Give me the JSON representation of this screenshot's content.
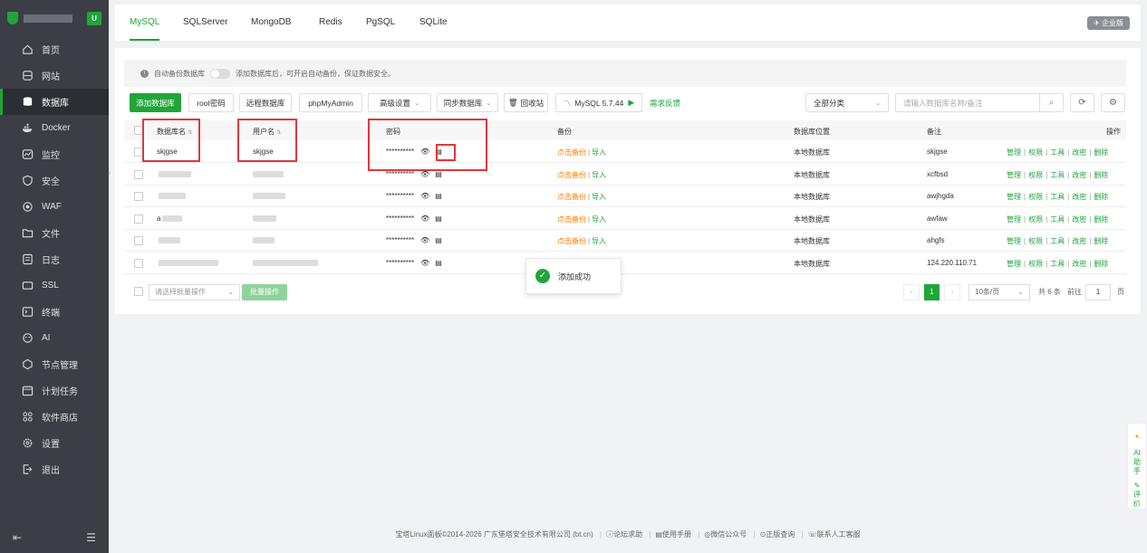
{
  "sidebar": {
    "badge": "U",
    "items": [
      {
        "label": "首页",
        "icon": "home-icon"
      },
      {
        "label": "网站",
        "icon": "globe-icon"
      },
      {
        "label": "数据库",
        "icon": "database-icon",
        "active": true
      },
      {
        "label": "Docker",
        "icon": "docker-icon"
      },
      {
        "label": "监控",
        "icon": "monitor-icon"
      },
      {
        "label": "安全",
        "icon": "shield-icon"
      },
      {
        "label": "WAF",
        "icon": "waf-icon"
      },
      {
        "label": "文件",
        "icon": "folder-icon"
      },
      {
        "label": "日志",
        "icon": "log-icon"
      },
      {
        "label": "SSL",
        "icon": "ssl-icon"
      },
      {
        "label": "终端",
        "icon": "terminal-icon"
      },
      {
        "label": "AI",
        "icon": "ai-icon"
      },
      {
        "label": "节点管理",
        "icon": "node-icon"
      },
      {
        "label": "计划任务",
        "icon": "calendar-icon"
      },
      {
        "label": "软件商店",
        "icon": "store-icon"
      },
      {
        "label": "设置",
        "icon": "gear-icon"
      },
      {
        "label": "退出",
        "icon": "logout-icon"
      }
    ]
  },
  "tabs": [
    "MySQL",
    "SQLServer",
    "MongoDB",
    "Redis",
    "PgSQL",
    "SQLite"
  ],
  "enterprise_badge": "企业版",
  "notice": {
    "label": "自动备份数据库",
    "text": "添加数据库后，可开启自动备份，保证数据安全。"
  },
  "toolbar": {
    "add_db": "添加数据库",
    "root_pwd": "root密码",
    "remote_db": "远程数据库",
    "phpmyadmin": "phpMyAdmin",
    "advanced": "高级设置",
    "sync_db": "同步数据库",
    "recycle": "回收站",
    "mysql_version": "MySQL 5.7.44",
    "feedback": "需求反馈",
    "category": "全部分类",
    "search_placeholder": "请输入数据库名称/备注"
  },
  "table": {
    "headers": {
      "name": "数据库名",
      "user": "用户名",
      "password": "密码",
      "backup": "备份",
      "location": "数据库位置",
      "remark": "备注",
      "actions": "操作"
    },
    "rows": [
      {
        "name": "skjgse",
        "user": "skjgse",
        "password": "**********",
        "backup": "点击备份",
        "import": "导入",
        "location": "本地数据库",
        "remark": "skjgse"
      },
      {
        "name": "",
        "user": "",
        "password": "**********",
        "backup": "点击备份",
        "import": "导入",
        "location": "本地数据库",
        "remark": "xcfbsd"
      },
      {
        "name": "",
        "user": "",
        "password": "**********",
        "backup": "点击备份",
        "import": "导入",
        "location": "本地数据库",
        "remark": "awjhgda"
      },
      {
        "name": "a",
        "user": "",
        "password": "**********",
        "backup": "点击备份",
        "import": "导入",
        "location": "本地数据库",
        "remark": "awfaw"
      },
      {
        "name": "",
        "user": "",
        "password": "**********",
        "backup": "点击备份",
        "import": "导入",
        "location": "本地数据库",
        "remark": "ahgfs"
      },
      {
        "name": "",
        "user": "",
        "password": "**********",
        "backup": "",
        "import": "",
        "location": "本地数据库",
        "remark": "124.220.110.71"
      }
    ],
    "actions": [
      "管理",
      "权限",
      "工具",
      "改密",
      "删除"
    ]
  },
  "batch": {
    "select_placeholder": "请选择批量操作",
    "button": "批量操作"
  },
  "pagination": {
    "current_page": "1",
    "page_size": "10条/页",
    "total": "共 6 条",
    "goto_label": "前往",
    "goto_value": "1",
    "page_unit": "页"
  },
  "toast": "添加成功",
  "ai_float": {
    "label1": "AI",
    "label2": "助",
    "label3": "手",
    "label4": "评",
    "label5": "价"
  },
  "footer": {
    "copyright": "宝塔Linux面板©2014-2026 广东堡塔安全技术有限公司 (bt.cn)",
    "links": [
      "论坛求助",
      "使用手册",
      "微信公众号",
      "正版查询",
      "联系人工客服"
    ]
  },
  "colors": {
    "accent": "#20a53a",
    "highlight_box": "#e0373d",
    "backup_link": "#ff7f00",
    "sidebar_bg": "#3b3f45"
  }
}
